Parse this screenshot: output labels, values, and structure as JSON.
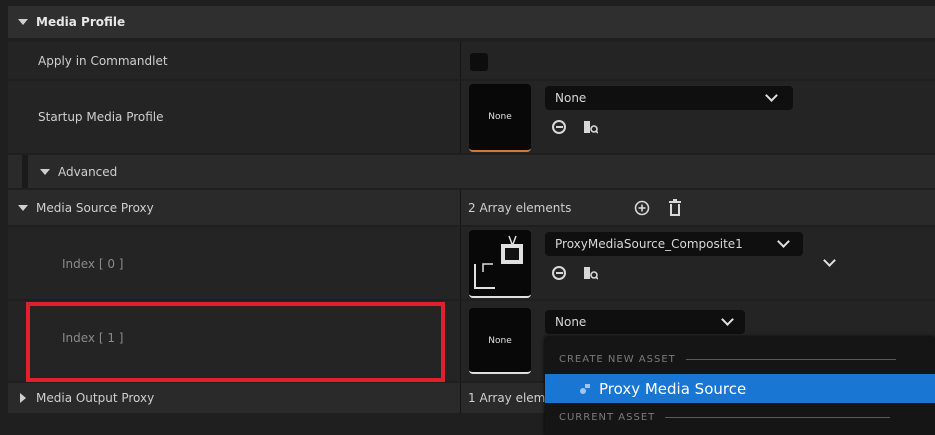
{
  "sections": {
    "media_profile": "Media Profile",
    "apply_in_commandlet": "Apply in Commandlet",
    "startup_media_profile": "Startup Media Profile",
    "advanced": "Advanced",
    "media_source_proxy": "Media Source Proxy",
    "media_source_proxy_count": "2 Array elements",
    "index0": "Index [ 0 ]",
    "index1": "Index [ 1 ]",
    "media_output_proxy": "Media Output Proxy",
    "media_output_proxy_count": "1 Array elem"
  },
  "startup": {
    "thumb": "None",
    "combo": "None"
  },
  "index0": {
    "combo": "ProxyMediaSource_Composite1"
  },
  "index1": {
    "thumb": "None",
    "combo": "None"
  },
  "dropdown": {
    "create_header": "CREATE NEW ASSET",
    "item": "Proxy Media Source",
    "current_header": "CURRENT ASSET"
  },
  "colors": {
    "highlight": "#1976d2",
    "annotation": "#e0202b"
  }
}
